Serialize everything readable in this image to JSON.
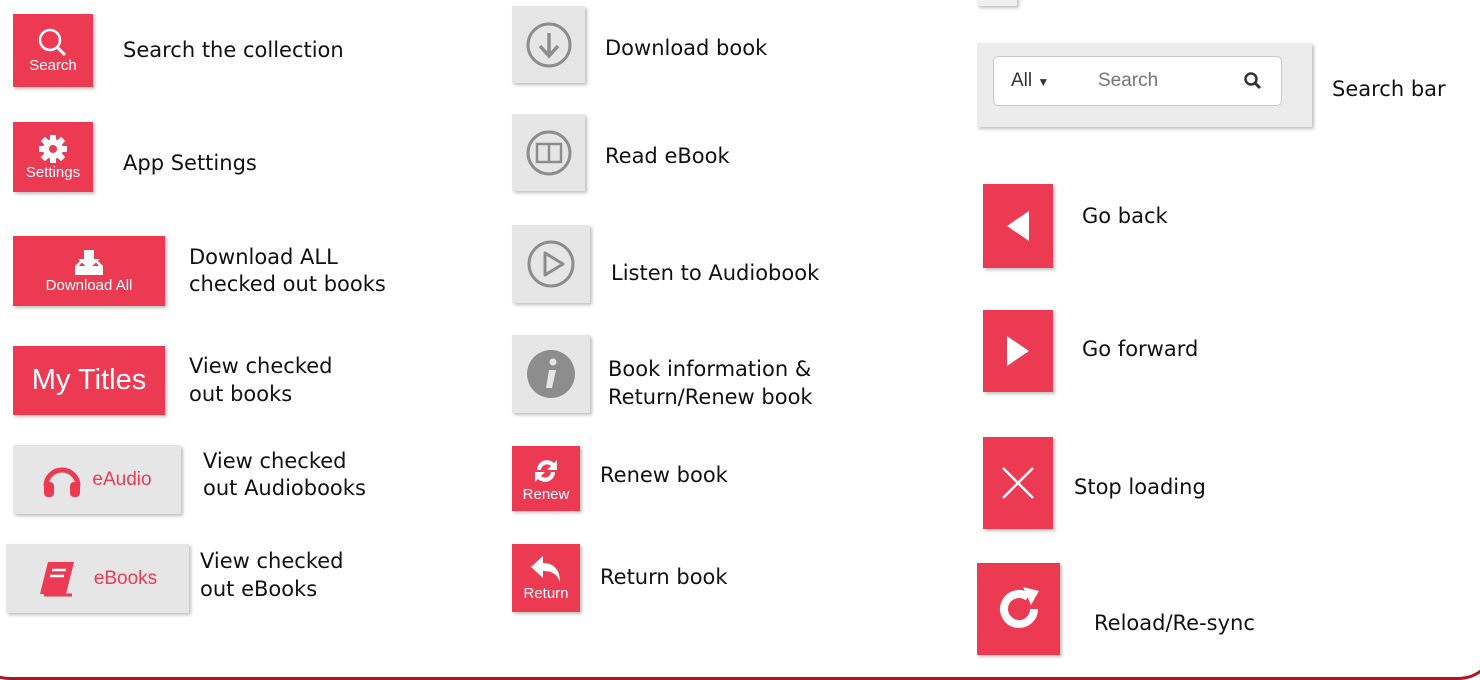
{
  "column1": {
    "search": {
      "button_text": "Search",
      "label": "Search the collection"
    },
    "settings": {
      "button_text": "Settings",
      "label": "App Settings"
    },
    "download_all": {
      "button_text": "Download All",
      "label_line1": "Download ALL",
      "label_line2": "checked out books"
    },
    "my_titles": {
      "button_text": "My Titles",
      "label_line1": "View checked",
      "label_line2": "out books"
    },
    "eaudio": {
      "button_text": "eAudio",
      "label_line1": "View checked",
      "label_line2": "out Audiobooks"
    },
    "ebooks": {
      "button_text": "eBooks",
      "label_line1": "View checked",
      "label_line2": "out eBooks"
    }
  },
  "column2": {
    "download": {
      "label": "Download book"
    },
    "read": {
      "label": "Read eBook"
    },
    "listen": {
      "label": "Listen to Audiobook"
    },
    "info": {
      "label_line1": "Book information &",
      "label_line2": "Return/Renew book"
    },
    "renew": {
      "button_text": "Renew",
      "label": "Renew book"
    },
    "return": {
      "button_text": "Return",
      "label": "Return book"
    }
  },
  "column3": {
    "search_bar": {
      "filter_value": "All",
      "placeholder": "Search",
      "label": "Search bar"
    },
    "back": {
      "label": "Go back"
    },
    "forward": {
      "label": "Go forward"
    },
    "stop": {
      "label": "Stop loading"
    },
    "reload": {
      "label": "Reload/Re-sync"
    }
  },
  "colors": {
    "accent": "#ec3a53",
    "grey_button": "#e6e6e6",
    "frame": "#b3131f"
  }
}
